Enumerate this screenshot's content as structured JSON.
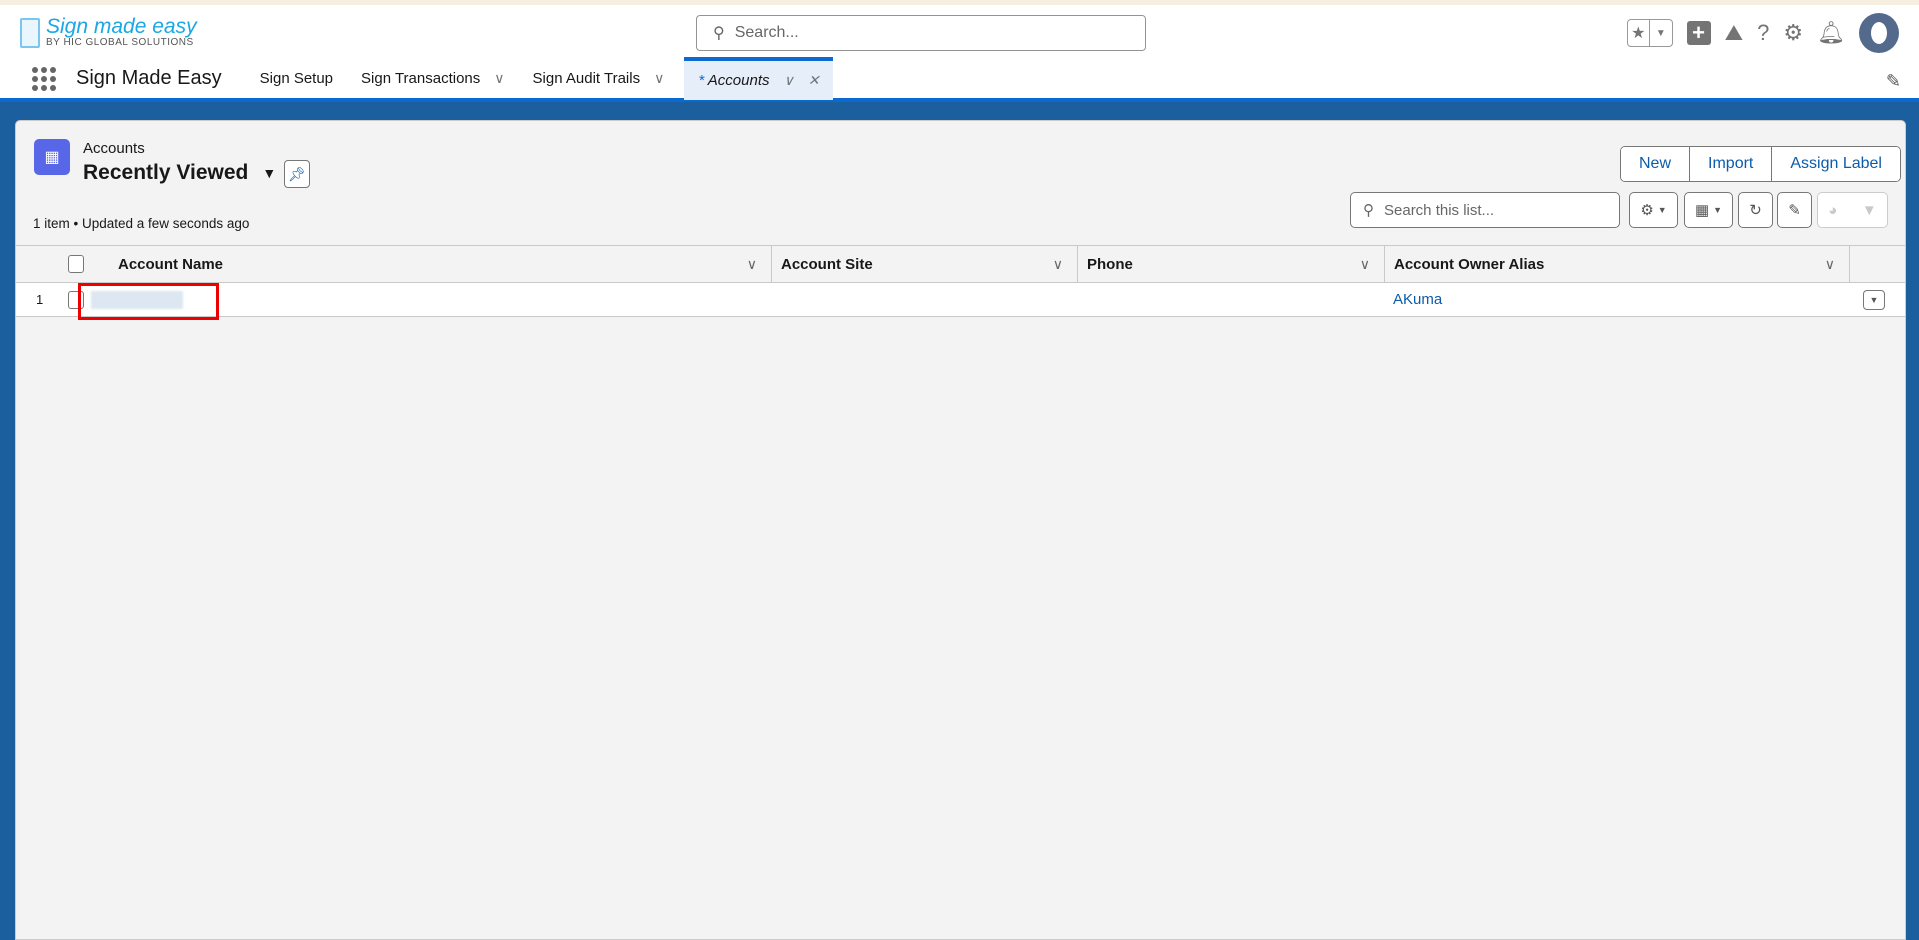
{
  "header": {
    "logo_title": "Sign made easy",
    "logo_subtitle": "BY HIC GLOBAL SOLUTIONS",
    "search_placeholder": "Search..."
  },
  "nav": {
    "app_name": "Sign Made Easy",
    "tabs": [
      {
        "label": "Sign Setup"
      },
      {
        "label": "Sign Transactions"
      },
      {
        "label": "Sign Audit Trails"
      },
      {
        "label": "Accounts",
        "prefix": "*"
      }
    ]
  },
  "list_view": {
    "object_label": "Accounts",
    "view_name": "Recently Viewed",
    "meta": "1 item • Updated a few seconds ago",
    "actions": [
      "New",
      "Import",
      "Assign Label"
    ],
    "search_placeholder": "Search this list...",
    "columns": [
      "Account Name",
      "Account Site",
      "Phone",
      "Account Owner Alias"
    ],
    "rows": [
      {
        "num": "1",
        "account_name": "",
        "account_site": "",
        "phone": "",
        "owner_alias": "AKuma"
      }
    ]
  }
}
